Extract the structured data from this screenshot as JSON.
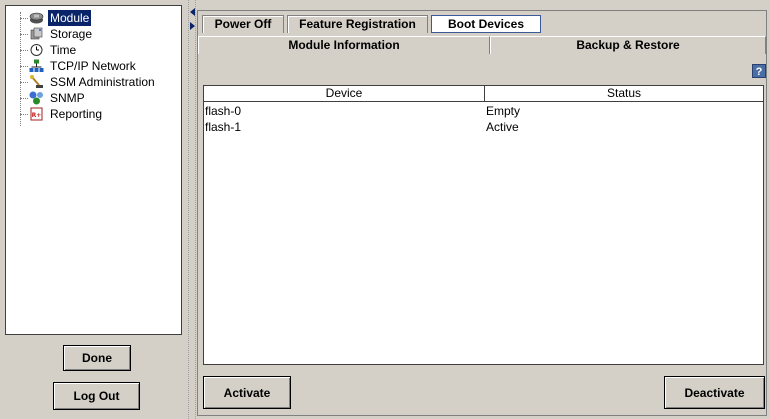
{
  "sidebar": {
    "items": [
      {
        "label": "Module",
        "icon": "module-icon",
        "selected": true
      },
      {
        "label": "Storage",
        "icon": "storage-icon"
      },
      {
        "label": "Time",
        "icon": "clock-icon"
      },
      {
        "label": "TCP/IP Network",
        "icon": "network-icon"
      },
      {
        "label": "SSM Administration",
        "icon": "admin-icon"
      },
      {
        "label": "SNMP",
        "icon": "snmp-icon"
      },
      {
        "label": "Reporting",
        "icon": "report-icon"
      }
    ],
    "done_label": "Done",
    "logout_label": "Log Out"
  },
  "tabs": {
    "row1": [
      "Power Off",
      "Feature Registration",
      "Boot Devices"
    ],
    "row2": [
      "Module Information",
      "Backup & Restore"
    ],
    "active": "Boot Devices"
  },
  "help_label": "?",
  "table": {
    "columns": [
      "Device",
      "Status"
    ],
    "rows": [
      {
        "device": "flash-0",
        "status": "Empty"
      },
      {
        "device": "flash-1",
        "status": "Active"
      }
    ]
  },
  "actions": {
    "activate_label": "Activate",
    "deactivate_label": "Deactivate"
  }
}
